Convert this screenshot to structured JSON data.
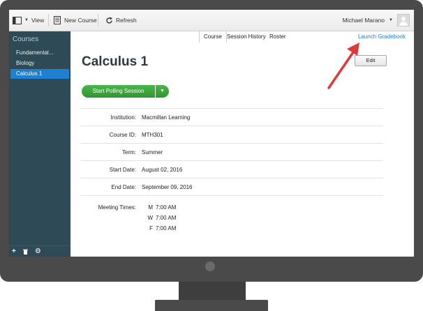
{
  "toolbar": {
    "view_label": "View",
    "new_course_label": "New Course",
    "refresh_label": "Refresh",
    "user_name": "Michael Marano"
  },
  "sidebar": {
    "title": "Courses",
    "items": [
      {
        "label": "Fundamental..."
      },
      {
        "label": "Biology"
      },
      {
        "label": "Calculus 1"
      }
    ],
    "footer_icons": [
      "plus-icon",
      "trash-icon",
      "gear-icon"
    ]
  },
  "tabs": [
    {
      "label": "Course"
    },
    {
      "label": "Session History"
    },
    {
      "label": "Roster"
    }
  ],
  "launch_gradebook": "Launch Gradebook",
  "main": {
    "title": "Calculus 1",
    "edit_label": "Edit",
    "start_polling_label": "Start Polling Session",
    "details": [
      {
        "label": "Institution:",
        "value": "Macmillan Learning"
      },
      {
        "label": "Course ID:",
        "value": "MTH301"
      },
      {
        "label": "Term:",
        "value": "Summer"
      },
      {
        "label": "Start Date:",
        "value": "August 02, 2016"
      },
      {
        "label": "End Date:",
        "value": "September 09, 2016"
      }
    ],
    "meeting_label": "Meeting Times:",
    "meeting_times": [
      {
        "day": "M",
        "time": "7:00 AM"
      },
      {
        "day": "W",
        "time": "7:00 AM"
      },
      {
        "day": "F",
        "time": "7:00 AM"
      }
    ]
  },
  "colors": {
    "sidebar_bg": "#2f4a57",
    "active_item": "#1f7fd1",
    "poll_button": "#3aa63a",
    "arrow": "#e0393b",
    "monitor": "#4a4a4a"
  }
}
